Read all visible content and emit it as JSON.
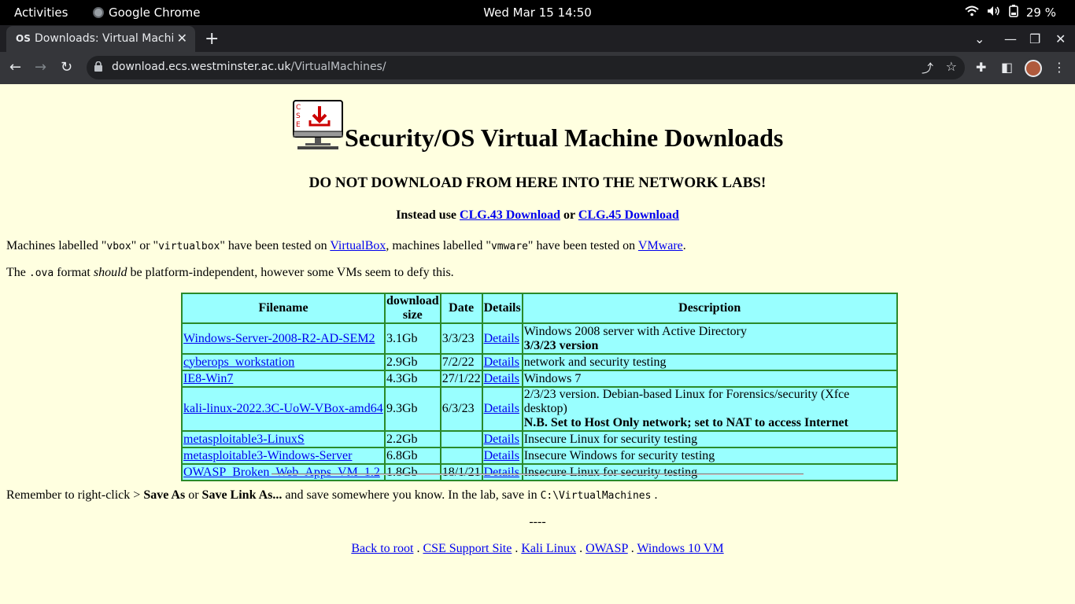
{
  "system_bar": {
    "activities": "Activities",
    "app_name": "Google Chrome",
    "clock": "Wed Mar 15  14:50",
    "battery": "29 %"
  },
  "browser": {
    "tab_title": "Downloads: Virtual Machi",
    "url_host": "download.ecs.westminster.ac.uk",
    "url_path": "/VirtualMachines/"
  },
  "page": {
    "title": "Security/OS Virtual Machine Downloads",
    "logo_letters": [
      "C",
      "S",
      "E"
    ],
    "warning": "DO NOT DOWNLOAD FROM HERE INTO THE NETWORK LABS!",
    "instead_prefix": "Instead use",
    "instead_link1": "CLG.43 Download",
    "instead_or": "or",
    "instead_link2": "CLG.45 Download",
    "p1_a": "Machines labelled \"",
    "p1_code1": "vbox",
    "p1_b": "\" or \"",
    "p1_code2": "virtualbox",
    "p1_c": "\" have been tested on ",
    "p1_link1": "VirtualBox",
    "p1_d": ", machines labelled \"",
    "p1_code3": "vmware",
    "p1_e": "\" have been tested on ",
    "p1_link2": "VMware",
    "p1_f": ".",
    "p2_a": "The ",
    "p2_code": ".ova",
    "p2_b": " format ",
    "p2_em": "should",
    "p2_c": " be platform-independent, however some VMs seem to defy this.",
    "remember_a": "Remember to right-click > ",
    "remember_b1": "Save As",
    "remember_or": " or ",
    "remember_b2": "Save Link As...",
    "remember_c": " and save somewhere you know. In the lab, save in ",
    "remember_code": "C:\\VirtualMachines",
    "remember_d": " .",
    "dashes": "----",
    "footer_links": [
      "Back to root",
      "CSE Support Site",
      "Kali Linux",
      "OWASP",
      "Windows 10 VM"
    ],
    "footer_sep": " . "
  },
  "table": {
    "headers": {
      "filename": "Filename",
      "size_line1": "download",
      "size_line2": "size",
      "date": "Date",
      "details": "Details",
      "description": "Description"
    },
    "rows": [
      {
        "filename": "Windows-Server-2008-R2-AD-SEM2",
        "size": "3.1Gb",
        "date": "3/3/23",
        "details": "Details",
        "desc": "Windows 2008 server with Active Directory",
        "desc_bold": "3/3/23 version"
      },
      {
        "filename": "cyberops_workstation",
        "size": "2.9Gb",
        "date": "7/2/22",
        "details": "Details",
        "desc": "network and security testing",
        "desc_bold": ""
      },
      {
        "filename": "IE8-Win7",
        "size": "4.3Gb",
        "date": "27/1/22",
        "details": "Details",
        "desc": "Windows 7",
        "desc_bold": ""
      },
      {
        "filename": "kali-linux-2022.3C-UoW-VBox-amd64",
        "size": "9.3Gb",
        "date": "6/3/23",
        "details": "Details",
        "desc": "2/3/23 version. Debian-based Linux for Forensics/security (Xfce desktop)",
        "desc_bold": "N.B. Set to Host Only network; set to NAT to access Internet"
      },
      {
        "filename": "metasploitable3-LinuxS",
        "size": "2.2Gb",
        "date": "",
        "details": "Details",
        "desc": "Insecure Linux for security testing",
        "desc_bold": ""
      },
      {
        "filename": "metasploitable3-Windows-Server",
        "size": "6.8Gb",
        "date": "",
        "details": "Details",
        "desc": "Insecure Windows for security testing",
        "desc_bold": ""
      },
      {
        "filename": "OWASP_Broken_Web_Apps_VM_1.2",
        "size": "1.8Gb",
        "date": "18/1/21",
        "details": "Details",
        "desc": "Insecure Linux for security testing",
        "desc_bold": ""
      }
    ]
  }
}
